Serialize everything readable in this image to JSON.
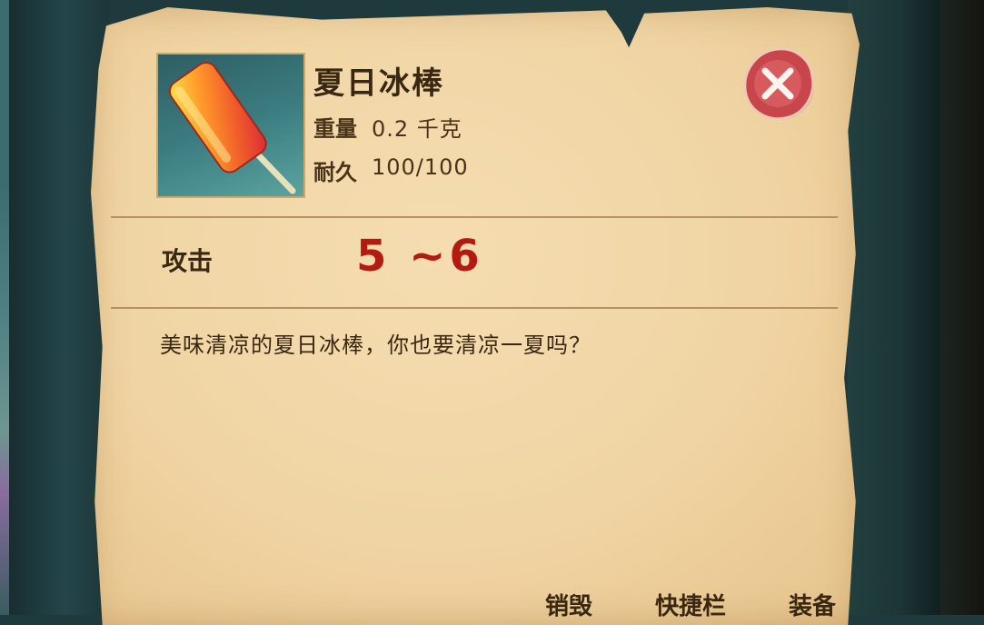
{
  "item": {
    "name": "夏日冰棒",
    "icon": "popsicle-icon",
    "weight_label": "重量",
    "weight_value": "0.2 千克",
    "durability_label": "耐久",
    "durability_value": "100/100"
  },
  "stats": {
    "attack_label": "攻击",
    "attack_value": "5 ~6"
  },
  "description": "美味清凉的夏日冰棒，你也要清凉一夏吗？",
  "actions": {
    "destroy_label": "销毁",
    "hotbar_label": "快捷栏",
    "equip_label": "装备"
  },
  "close_icon": "close-icon",
  "colors": {
    "parchment": "#f0d4a3",
    "attack_value": "#b21a12",
    "close_button": "#c8454a",
    "text": "#3a2712"
  }
}
